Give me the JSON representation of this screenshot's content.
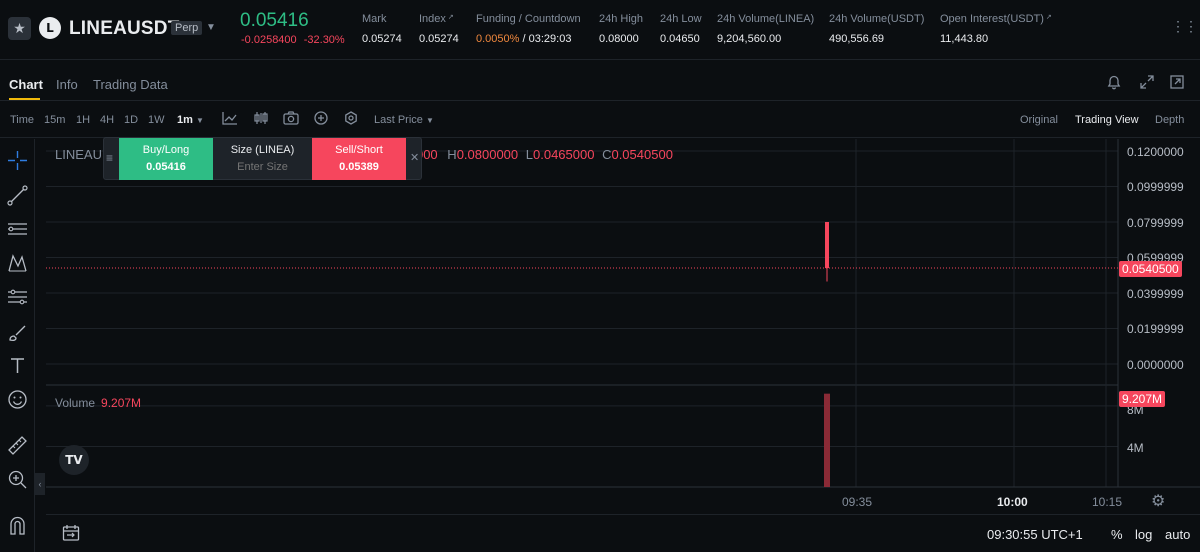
{
  "header": {
    "symbol": "LINEAUSDT",
    "logo_letter": "L",
    "badge": "Perp",
    "last_price": "0.05416",
    "change_abs": "-0.0258400",
    "change_pct": "-32.30%",
    "stats": [
      {
        "label": "Mark",
        "value": "0.05274"
      },
      {
        "label": "Index",
        "value": "0.05274"
      },
      {
        "label": "Funding / Countdown",
        "value_rate": "0.0050%",
        "value_time": "/ 03:29:03"
      },
      {
        "label": "24h High",
        "value": "0.08000"
      },
      {
        "label": "24h Low",
        "value": "0.04650"
      },
      {
        "label": "24h Volume(LINEA)",
        "value": "9,204,560.00"
      },
      {
        "label": "24h Volume(USDT)",
        "value": "490,556.69"
      },
      {
        "label": "Open Interest(USDT)",
        "value": "11,443.80"
      }
    ]
  },
  "tabs": [
    "Chart",
    "Info",
    "Trading Data"
  ],
  "toolbar": {
    "intervals": [
      "Time",
      "15m",
      "1H",
      "4H",
      "1D",
      "1W",
      "1m"
    ],
    "price_type": "Last Price",
    "views": [
      "Original",
      "Trading View",
      "Depth"
    ]
  },
  "chart": {
    "symbol_label": "LINEAU",
    "ohlc": {
      "o_tail": "000",
      "h": "0.0800000",
      "l": "0.0465000",
      "c": "0.0540500"
    },
    "volume_label": "Volume",
    "volume_value": "9.207M",
    "price_ticks": [
      "0.1200000",
      "0.0999999",
      "0.0799999",
      "0.0599999",
      "0.0399999",
      "0.0199999",
      "0.0000000"
    ],
    "current_price_tag": "0.0540500",
    "volume_ticks": [
      "8M",
      "4M"
    ],
    "volume_tag": "9.207M",
    "time_ticks": [
      "09:35",
      "10:00",
      "10:15"
    ],
    "candle": {
      "open": 0.08,
      "high": 0.08,
      "low": 0.0465,
      "close": 0.05405,
      "volume": 9207000
    },
    "colors": {
      "down": "#f6465d",
      "up": "#2ebd85",
      "grid": "#1e2329"
    }
  },
  "order_panel": {
    "buy_label": "Buy/Long",
    "buy_price": "0.05416",
    "size_label": "Size (LINEA)",
    "size_placeholder": "Enter Size",
    "sell_label": "Sell/Short",
    "sell_price": "0.05389"
  },
  "footer": {
    "clock": "09:30:55 UTC+1",
    "percent": "%",
    "log": "log",
    "auto": "auto"
  }
}
